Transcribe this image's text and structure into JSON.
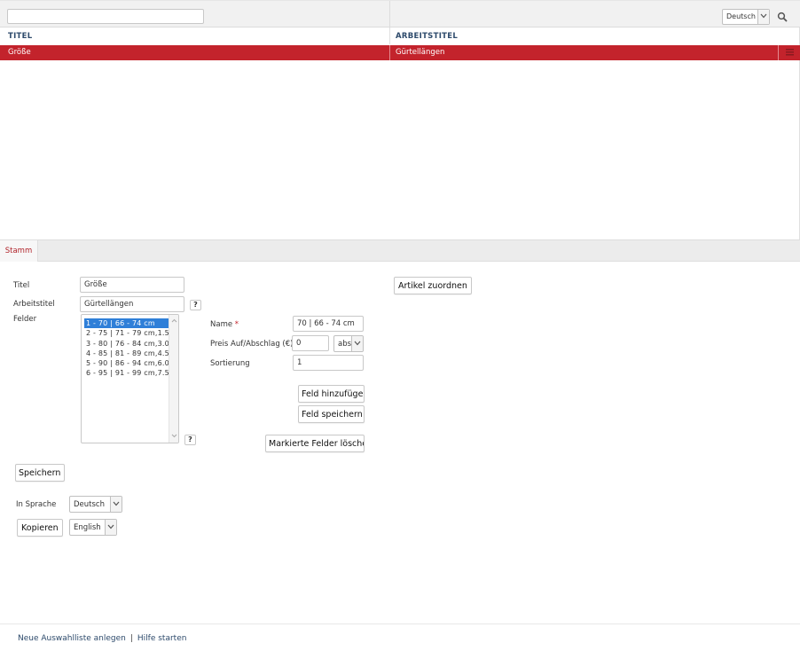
{
  "list": {
    "filter_value": "",
    "language": "Deutsch",
    "columns": [
      "TITEL",
      "ARBEITSTITEL"
    ],
    "rows": [
      {
        "title": "Größe",
        "work_title": "Gürtellängen",
        "selected": true
      }
    ]
  },
  "tabs": [
    {
      "label": "Stamm",
      "active": true
    }
  ],
  "form": {
    "title_label": "Titel",
    "title_value": "Größe",
    "worktitle_label": "Arbeitstitel",
    "worktitle_value": "Gürtellängen",
    "fields_label": "Felder",
    "fields": [
      "1 - 70 | 66 - 74 cm",
      "2 - 75 | 71 - 79 cm,1.5",
      "3 - 80 | 76 - 84 cm,3.0",
      "4 - 85 | 81 - 89 cm,4.5",
      "5 - 90 | 86 - 94 cm,6.0",
      "6 - 95 | 91 - 99 cm,7.5"
    ],
    "selected_field": 0,
    "help": "?",
    "name_label": "Name",
    "required_mark": "*",
    "name_value": "70 | 66 - 74 cm",
    "price_label": "Preis Auf/Abschlag (€)",
    "price_value": "0",
    "price_mode": "abs",
    "sort_label": "Sortierung",
    "sort_value": "1",
    "add_field_button": "Feld hinzufügen",
    "save_field_button": "Feld speichern",
    "delete_fields_button": "Markierte Felder löschen",
    "save_button": "Speichern",
    "assign_articles_button": "Artikel zuordnen",
    "in_language_label": "In Sprache",
    "in_language_value": "Deutsch",
    "copy_button": "Kopieren",
    "copy_language_value": "English"
  },
  "footer": {
    "new_list_link": "Neue Auswahlliste anlegen",
    "separator": "|",
    "help_link": "Hilfe starten"
  },
  "colors": {
    "accent_red": "#c3232c",
    "header_blue": "#2d4a6b",
    "selection_blue": "#2f7fd8"
  }
}
